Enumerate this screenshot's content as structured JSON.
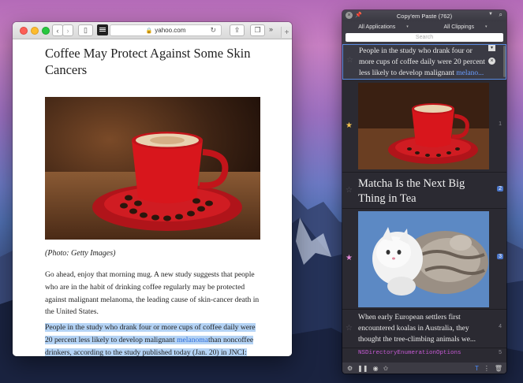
{
  "safari": {
    "url": "yahoo.com",
    "title": "Coffee May Protect Against Some Skin Cancers",
    "caption": "(Photo: Getty Images)",
    "para1": "Go ahead, enjoy that morning mug. A new study suggests that people who are in the habit of drinking coffee regularly may be protected against malignant melanoma, the leading cause of skin-cancer death in the United States.",
    "para2_a": "People in the study who drank four or more cups of coffee daily were 20 percent less likely to develop malignant ",
    "para2_link": "melanoma",
    "para2_b": "than noncoffee drinkers, according to the study published today (Jan. 20) in JNCI: Journal of the National Cancer Institute."
  },
  "panel": {
    "title": "Copy'em Paste (762)",
    "filter_apps": "All Applications",
    "filter_clips": "All Clippings",
    "search_placeholder": "Search",
    "clips": [
      {
        "text": "People in the study who drank four or more cups of coffee daily were 20 percent less likely to develop malignant ",
        "link": "melano...",
        "num": ""
      },
      {
        "text": "",
        "num": "1",
        "starred": true,
        "star_color": "#f2c14e"
      },
      {
        "text": "Matcha Is the Next Big Thing in Tea",
        "num": "2"
      },
      {
        "text": "",
        "num": "3",
        "starred": true,
        "star_color": "#e58ad9"
      },
      {
        "text": "When early European settlers first encountered koalas in Australia, they thought the tree-climbing animals we...",
        "num": "4"
      },
      {
        "text": "NSDirectoryEnumerationOptions",
        "num": "5"
      }
    ]
  },
  "colors": {
    "accent": "#5a8ae0",
    "highlight": "#b4d3f5",
    "link": "#2d6bd9"
  }
}
